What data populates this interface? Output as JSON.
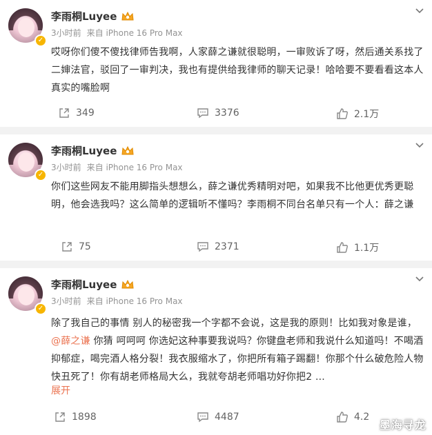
{
  "posts": [
    {
      "author": "李雨桐Luyee",
      "time": "3小时前",
      "source": "来自 iPhone 16 Pro Max",
      "text": "哎呀你们傻不傻找律师告我啊，人家薛之谦就很聪明，一审败诉了呀，然后通关系找了二婶法官，驳回了一审判决，我也有提供给我律师的聊天记录！哈哈要不要看看这本人真实的嘴脸啊",
      "reposts": "349",
      "comments": "3376",
      "likes": "2.1万"
    },
    {
      "author": "李雨桐Luyee",
      "time": "3小时前",
      "source": "来自 iPhone 16 Pro Max",
      "text": "你们这些网友不能用脚指头想想么，薛之谦优秀精明对吧，如果我不比他更优秀更聪明，他会选我吗？这么简单的逻辑听不懂吗？李雨桐不同台名单只有一个人：薛之谦",
      "reposts": "75",
      "comments": "2371",
      "likes": "1.1万"
    },
    {
      "author": "李雨桐Luyee",
      "time": "3小时前",
      "source": "来自 iPhone 16 Pro Max",
      "text_before": "除了我自己的事情 别人的秘密我一个字都不会说，这是我的原则！比如我对象是谁，",
      "mention": "@薛之谦",
      "text_after": " 你猜 呵呵呵 你选妃这种事要我说吗？你键盘老师和我说什么知道吗！不喝酒抑郁症，喝完酒人格分裂！我衣服缩水了，你把所有箱子踢翻！你那个什么破危险人物快丑死了！你有胡老师格局大么，我就夸胡老师唱功好你把2 ...",
      "expand": "展开",
      "reposts": "1898",
      "comments": "4487",
      "likes": "4.2"
    }
  ],
  "watermark": "墨海寻龙",
  "colors": {
    "accent": "#eb7350",
    "meta": "#939393",
    "badge": "#f7b500"
  }
}
